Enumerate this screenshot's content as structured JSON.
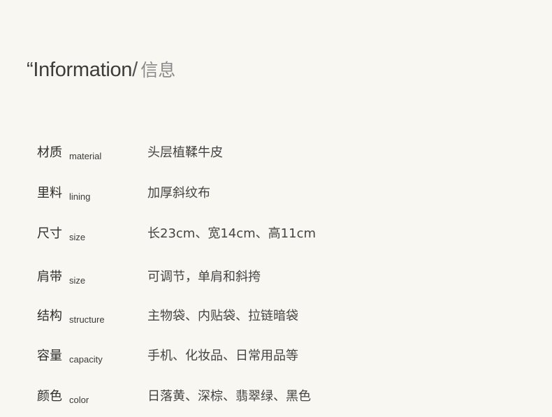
{
  "title": {
    "english": "“Information",
    "separator": "/",
    "chinese": "信息"
  },
  "specs": [
    {
      "label_cn": "材质",
      "label_en": "material",
      "value": "头层植鞣牛皮"
    },
    {
      "label_cn": "里料",
      "label_en": "lining",
      "value": "加厚斜纹布"
    },
    {
      "label_cn": "尺寸",
      "label_en": "size",
      "value": "长23cm、宽14cm、高11cm"
    },
    {
      "label_cn": "肩带",
      "label_en": "size",
      "value": "可调节，单肩和斜挎"
    },
    {
      "label_cn": "结构",
      "label_en": "structure",
      "value": "主物袋、内贴袋、拉链暗袋"
    },
    {
      "label_cn": "容量",
      "label_en": "capacity",
      "value": "手机、化妆品、日常用品等"
    },
    {
      "label_cn": "颜色",
      "label_en": "color",
      "value": "日落黄、深棕、翡翠绿、黑色"
    }
  ]
}
